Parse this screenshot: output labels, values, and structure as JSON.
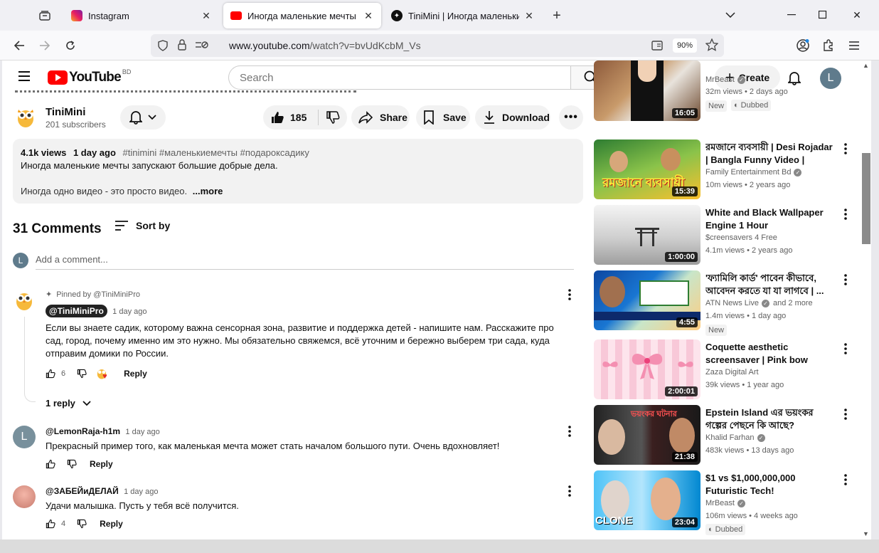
{
  "browser": {
    "tabs": [
      {
        "title": "Instagram",
        "active": false
      },
      {
        "title": "Иногда маленькие мечты запу",
        "active": true
      },
      {
        "title": "TiniMini | Иногда маленькие м",
        "active": false
      }
    ],
    "new_tab": "+",
    "url_host": "www.youtube.com",
    "url_path": "/watch?v=bvUdKcbM_Vs",
    "zoom": "90%"
  },
  "yt": {
    "logo_text": "YouTube",
    "country_code": "BD",
    "search_placeholder": "Search",
    "create_label": "Create",
    "avatar_letter": "L"
  },
  "video": {
    "channel_name": "TiniMini",
    "subscribers": "201 subscribers",
    "likes": "185",
    "share_label": "Share",
    "save_label": "Save",
    "download_label": "Download",
    "views": "4.1k views",
    "posted": "1 day ago",
    "tags": "#tinimini #маленькиемечты #подароксадику",
    "desc_line1": "Иногда маленькие мечты запускают большие добрые дела.",
    "desc_line2": "Иногда одно видео - это просто видео.",
    "more_label": "...more"
  },
  "comments": {
    "count_label": "31 Comments",
    "sort_label": "Sort by",
    "add_placeholder": "Add a comment...",
    "add_avatar": "L",
    "pinned_by": "Pinned by @TiniMiniPro",
    "reply_label": "Reply",
    "items": [
      {
        "handle": "@TiniMiniPro",
        "time": "1 day ago",
        "text": "Если вы знаете садик, которому важна сенсорная зона, развитие и поддержка детей - напишите нам. Расскажите про сад, город, почему именно им это нужно. Мы обязательно свяжемся, всё уточним и бережно выберем три сада, куда отправим домики по России.",
        "likes": "6",
        "replies": "1 reply"
      },
      {
        "handle": "@LemonRaja-h1m",
        "time": "1 day ago",
        "text": "Прекрасный пример того, как маленькая мечта может стать началом большого пути. Очень вдохновляет!",
        "likes": "",
        "avatar": "L"
      },
      {
        "handle": "@ЗАБЕЙиДЕЛАЙ",
        "time": "1 day ago",
        "text": "Удачи малышка. Пусть у тебя всё получится.",
        "likes": "4"
      }
    ]
  },
  "related": [
    {
      "title": "",
      "channel": "MrBeast",
      "meta": "32m views • 2 days ago",
      "duration": "16:05",
      "badges": [
        "New",
        "Dubbed"
      ]
    },
    {
      "title": "রমজানে ব্যবসায়ী | Desi Rojadar | Bangla Funny Video | Family ...",
      "channel": "Family Entertainment Bd",
      "meta": "10m views • 2 years ago",
      "duration": "15:39"
    },
    {
      "title": "White and Black Wallpaper Engine 1 Hour",
      "channel": "$creensavers 4 Free",
      "meta": "4.1m views • 2 years ago",
      "duration": "1:00:00"
    },
    {
      "title": "'ফ্যামিলি কার্ড' পাবেন কীভাবে, আবেদন করতে যা যা লাগবে | ...",
      "channel": "ATN News Live",
      "channel_extra": "and 2 more",
      "meta": "1.4m views • 1 day ago",
      "duration": "4:55",
      "badges": [
        "New"
      ]
    },
    {
      "title": "Coquette aesthetic screensaver | Pink bow wallpaper | Trendy ...",
      "channel": "Zaza Digital Art",
      "meta": "39k views • 1 year ago",
      "duration": "2:00:01"
    },
    {
      "title": "Epstein Island এর ভয়ংকর গল্পের পেছনে কি আছে?",
      "channel": "Khalid Farhan",
      "meta": "483k views • 13 days ago",
      "duration": "21:38"
    },
    {
      "title": "$1 vs $1,000,000,000 Futuristic Tech!",
      "channel": "MrBeast",
      "meta": "106m views • 4 weeks ago",
      "duration": "23:04",
      "badges": [
        "Dubbed"
      ],
      "thumb_label": "CLONE"
    }
  ]
}
